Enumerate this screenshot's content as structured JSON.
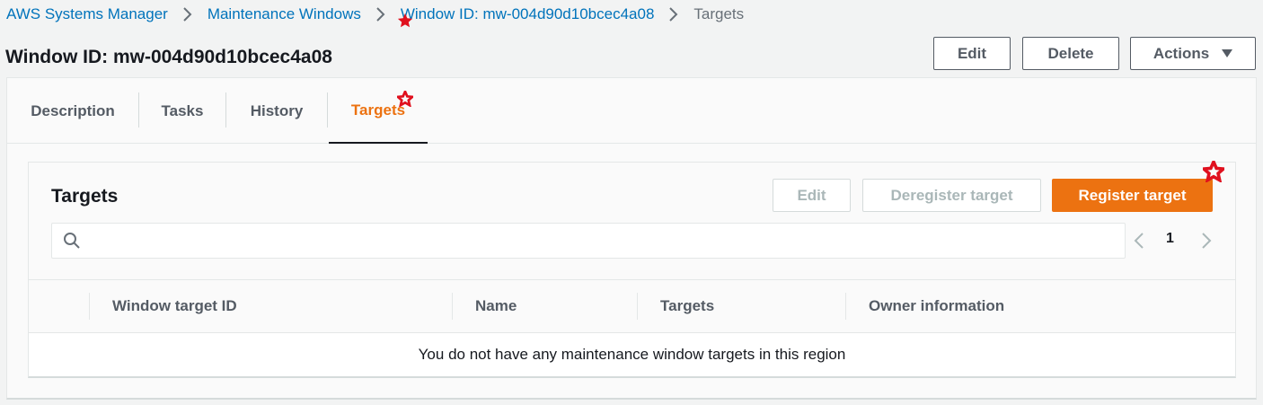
{
  "breadcrumb": {
    "items": [
      {
        "label": "AWS Systems Manager"
      },
      {
        "label": "Maintenance Windows"
      },
      {
        "label": "Window ID: mw-004d90d10bcec4a08"
      },
      {
        "label": "Targets"
      }
    ]
  },
  "header": {
    "title": "Window ID: mw-004d90d10bcec4a08",
    "edit_label": "Edit",
    "delete_label": "Delete",
    "actions_label": "Actions"
  },
  "tabs": [
    {
      "label": "Description"
    },
    {
      "label": "Tasks"
    },
    {
      "label": "History"
    },
    {
      "label": "Targets",
      "active": true
    }
  ],
  "targets_card": {
    "title": "Targets",
    "edit_label": "Edit",
    "deregister_label": "Deregister target",
    "register_label": "Register target",
    "search_placeholder": "",
    "page": "1",
    "columns": [
      "Window target ID",
      "Name",
      "Targets",
      "Owner information"
    ],
    "empty_message": "You do not have any maintenance window targets in this region"
  },
  "colors": {
    "link": "#0073bb",
    "accent": "#ec7211",
    "marker": "#e0101e"
  }
}
